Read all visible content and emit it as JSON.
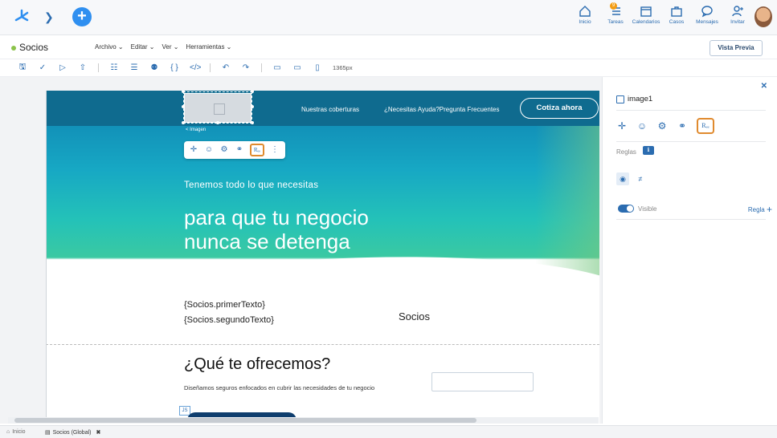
{
  "topnav": {
    "items": [
      {
        "label": "Inicio",
        "icon": "home-icon"
      },
      {
        "label": "Tareas",
        "icon": "tasks-icon",
        "badge": "9"
      },
      {
        "label": "Calendarios",
        "icon": "calendar-icon"
      },
      {
        "label": "Casos",
        "icon": "briefcase-icon"
      },
      {
        "label": "Mensajes",
        "icon": "chat-icon"
      },
      {
        "label": "Invitar",
        "icon": "invite-user-icon"
      }
    ]
  },
  "app": {
    "title": "Socios",
    "menus": [
      "Archivo",
      "Editar",
      "Ver",
      "Herramientas"
    ],
    "preview_label": "Vista Previa"
  },
  "toolbar": {
    "width_label": "1365px"
  },
  "canvas": {
    "nav_links": [
      "Nuestras coberturas",
      "¿Necesitas Ayuda?Pregunta Frecuentes"
    ],
    "cta_label": "Cotiza ahora",
    "selection_label": "< Imagen",
    "hero_kicker": "Tenemos todo lo que necesitas",
    "hero_title_line1": "para que tu negocio",
    "hero_title_line2": "nunca se detenga",
    "text_line1": "{Socios.primerTexto}",
    "text_line2": "{Socios.segundoTexto}",
    "socios_label": "Socios",
    "offer_title": "¿Qué te ofrecemos?",
    "offer_text": "Diseñamos seguros enfocados en cubrir las necesidades de tu negocio",
    "js_badge": "JS"
  },
  "panel": {
    "title": "image1",
    "rules_label": "Reglas",
    "visible_label": "Visible",
    "regla_link": "Regla",
    "active_tab_label": "Rₑₑ"
  },
  "bottom_tabs": [
    {
      "label": "Inicio",
      "active": false
    },
    {
      "label": "Socios (Global)",
      "active": true
    }
  ],
  "colors": {
    "accent": "#2b6cb0",
    "active_outline": "#e08a2e",
    "hero_dark": "#0f6b8f"
  }
}
